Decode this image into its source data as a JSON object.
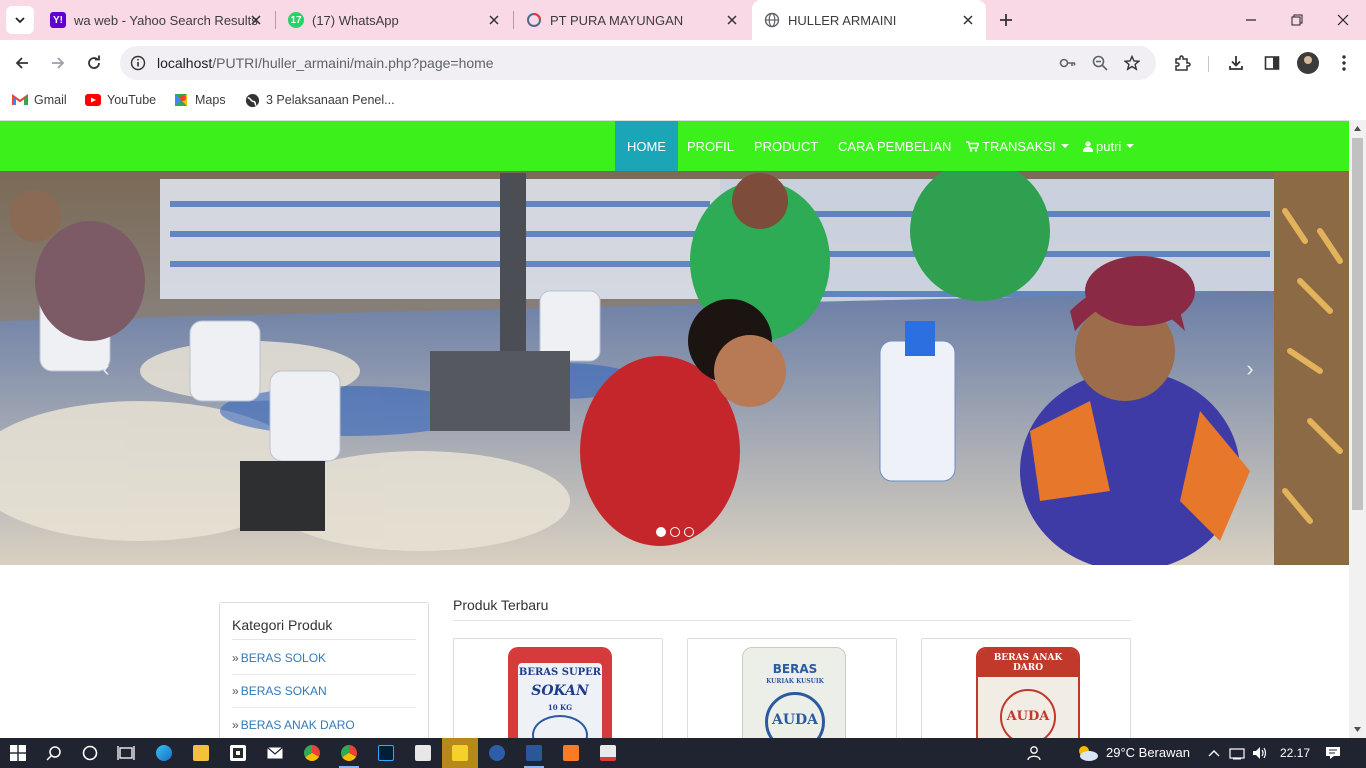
{
  "browser": {
    "tabs": [
      {
        "title": "wa web - Yahoo Search Results",
        "favicon": "yahoo-icon",
        "color": "#6001d2"
      },
      {
        "title": "(17) WhatsApp",
        "favicon": "whatsapp-icon",
        "badge": "17",
        "color": "#25d366"
      },
      {
        "title": "PT PURA MAYUNGAN",
        "favicon": "loading-icon",
        "color": "#e53935"
      },
      {
        "title": "HULLER ARMAINI",
        "favicon": "globe-icon",
        "active": true
      }
    ],
    "address": {
      "host": "localhost",
      "path": "/PUTRI/huller_armaini/main.php?page=home"
    },
    "bookmarks": [
      {
        "label": "Gmail",
        "icon": "gmail-icon"
      },
      {
        "label": "YouTube",
        "icon": "youtube-icon"
      },
      {
        "label": "Maps",
        "icon": "maps-icon"
      },
      {
        "label": "3 Pelaksanaan Penel...",
        "icon": "globe-icon"
      }
    ]
  },
  "site": {
    "nav": {
      "home": "HOME",
      "profil": "PROFIL",
      "product": "PRODUCT",
      "cara_pembelian": "CARA PEMBELIAN",
      "transaksi": "TRANSAKSI",
      "user": "putri",
      "active": "HOME",
      "bar_color": "#3cf01c",
      "active_color": "#1aa6b6"
    },
    "carousel": {
      "slide_count": 3,
      "active_slide": 1,
      "prev_glyph": "‹",
      "next_glyph": "›"
    },
    "sidebar": {
      "title": "Kategori Produk",
      "raquo": "»",
      "categories": [
        "BERAS SOLOK",
        "BERAS SOKAN",
        "BERAS ANAK DARO"
      ]
    },
    "products": {
      "title": "Produk Terbaru",
      "items": [
        {
          "bag_line1": "BERAS SUPER",
          "bag_line2": "SOKAN",
          "bag_note": "10 KG",
          "bag_color": "#d63b3b"
        },
        {
          "bag_line1": "BERAS",
          "bag_line2": "KURIAK KUSUIK",
          "bag_brand": "AUDA",
          "bag_color": "#2c5aa0"
        },
        {
          "bag_line1": "BERAS ANAK DARO",
          "bag_brand": "AUDA",
          "bag_color": "#c0392b"
        }
      ]
    }
  },
  "taskbar": {
    "weather": "29°C  Berawan",
    "clock": "22.17"
  }
}
